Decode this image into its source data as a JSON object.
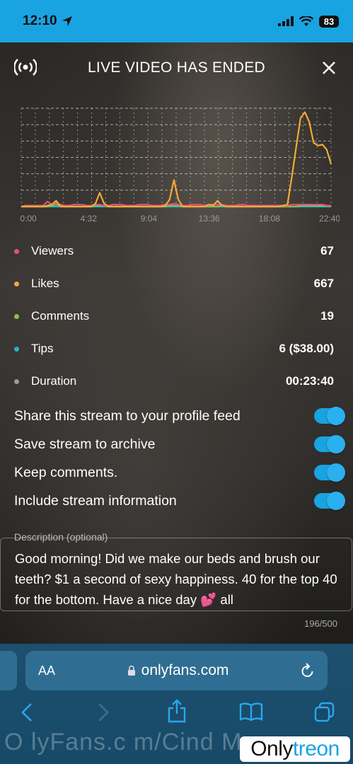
{
  "status_bar": {
    "time": "12:10",
    "battery": "83"
  },
  "header": {
    "title": "LIVE VIDEO HAS ENDED"
  },
  "chart_data": {
    "type": "line",
    "x_ticks": [
      "0:00",
      "4:32",
      "9:04",
      "13:36",
      "18:08",
      "22:40"
    ],
    "series": [
      {
        "color": "#f2a93b",
        "values": [
          0,
          0,
          0,
          0,
          0,
          0,
          1,
          2,
          6,
          0,
          0,
          0,
          0,
          0,
          0,
          0,
          0,
          3,
          14,
          3,
          0,
          0,
          0,
          0,
          0,
          0,
          0,
          0,
          0,
          0,
          0,
          0,
          0,
          1,
          7,
          27,
          7,
          0,
          0,
          0,
          0,
          0,
          0,
          2,
          1,
          6,
          1,
          0,
          0,
          0,
          0,
          0,
          0,
          0,
          0,
          0,
          0,
          0,
          0,
          0,
          1,
          2,
          30,
          60,
          90,
          96,
          86,
          65,
          62,
          63,
          58,
          43
        ]
      },
      {
        "color": "#e84e78",
        "values": [
          0,
          1,
          1,
          1,
          1,
          1,
          5,
          2,
          4,
          2,
          1,
          1,
          2,
          2,
          2,
          1,
          1,
          2,
          2,
          1,
          1,
          2,
          2,
          2,
          1,
          1,
          1,
          2,
          2,
          2,
          1,
          1,
          1,
          2,
          2,
          3,
          2,
          1,
          1,
          2,
          2,
          2,
          1,
          2,
          2,
          2,
          2,
          1,
          1,
          1,
          2,
          2,
          1,
          1,
          1,
          1,
          1,
          1,
          1,
          1,
          1,
          1,
          2,
          2,
          2,
          2,
          2,
          2,
          2,
          2,
          1,
          1
        ]
      },
      {
        "color": "#8dbf4e",
        "values": [
          0,
          0,
          0,
          0,
          0,
          0,
          0,
          1,
          2,
          1,
          0,
          0,
          0,
          0,
          0,
          0,
          0,
          1,
          1,
          1,
          0,
          0,
          0,
          0,
          0,
          0,
          0,
          0,
          0,
          0,
          0,
          0,
          0,
          0,
          1,
          1,
          1,
          0,
          0,
          0,
          0,
          0,
          0,
          0,
          0,
          0,
          1,
          0,
          0,
          0,
          0,
          0,
          0,
          0,
          0,
          0,
          0,
          0,
          0,
          0,
          0,
          0,
          0,
          0,
          1,
          1,
          1,
          1,
          1,
          1,
          1,
          0
        ]
      },
      {
        "color": "#26b5c7",
        "values": [
          0,
          0,
          0,
          0,
          0,
          0,
          0,
          0,
          0,
          0,
          0,
          0,
          0,
          0,
          0,
          0,
          0,
          0,
          0,
          0,
          0,
          0,
          0,
          0,
          0,
          0,
          0,
          0,
          0,
          0,
          0,
          0,
          0,
          0,
          0,
          0,
          0,
          0,
          0,
          0,
          0,
          0,
          0,
          0,
          0,
          0,
          0,
          0,
          0,
          0,
          0,
          0,
          0,
          0,
          0,
          0,
          0,
          0,
          0,
          0,
          0,
          0,
          0,
          0,
          0,
          0,
          0,
          0,
          0,
          0,
          0,
          0
        ]
      }
    ],
    "ylim": [
      0,
      100
    ],
    "grid": true
  },
  "stats": [
    {
      "label": "Viewers",
      "value": "67",
      "color": "#e84e78"
    },
    {
      "label": "Likes",
      "value": "667",
      "color": "#f2a93b"
    },
    {
      "label": "Comments",
      "value": "19",
      "color": "#8dbf4e"
    },
    {
      "label": "Tips",
      "value": "6 ($38.00)",
      "color": "#26b5c7"
    },
    {
      "label": "Duration",
      "value": "00:23:40",
      "color": "#9a9a9a"
    }
  ],
  "toggles": [
    {
      "label": "Share this stream to your profile feed",
      "on": true
    },
    {
      "label": "Save stream to archive",
      "on": true
    },
    {
      "label": "Keep comments.",
      "on": true
    },
    {
      "label": "Include stream information",
      "on": true
    }
  ],
  "description": {
    "label": "Description (optional)",
    "text": "Good morning! Did we make our beds and brush our teeth? $1 a second of sexy happiness. 40 for the top 40 for the bottom. Have a nice day 💕 all",
    "count": "196/500"
  },
  "browser": {
    "aa": "AA",
    "url": "onlyfans.com"
  },
  "watermark": {
    "text": "O lyFans.c m/Cind  M",
    "logo_main": "Only",
    "logo_accent": "treon"
  }
}
